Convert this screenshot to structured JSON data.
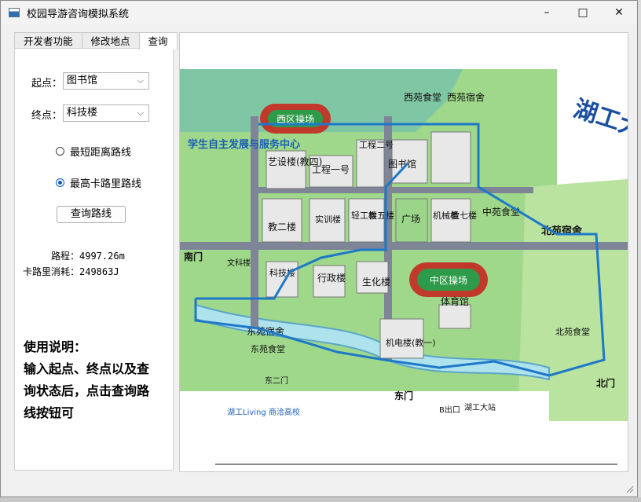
{
  "window": {
    "title": "校园导游咨询模拟系统",
    "min_icon": "minimize-icon",
    "max_icon": "maximize-icon",
    "close_icon": "close-icon"
  },
  "tabs": [
    "开发者功能",
    "修改地点",
    "查询"
  ],
  "active_tab": "查询",
  "form": {
    "start_label": "起点：",
    "start_value": "图书馆",
    "end_label": "终点：",
    "end_value": "科技楼",
    "option_short": "最短距离路线",
    "option_calorie": "最高卡路里路线",
    "selected_option": "最高卡路里路线",
    "query_button": "查询路线"
  },
  "result": {
    "distance": "路程：4997.26m",
    "calories": "卡路里消耗：249863J"
  },
  "help": {
    "title": "使用说明：",
    "text": "输入起点、终点以及查询状态后，点击查询路线按钮可"
  },
  "map": {
    "title": "湖工大地图",
    "banner": "学生自主发展与服务中心",
    "labels": {
      "west_field": "西区操场",
      "west_canteen": "西苑食堂",
      "west_dorm": "西苑宿舍",
      "art": "艺设楼(教四)",
      "eng1": "工程一号",
      "eng2": "工程二号",
      "library": "图书馆",
      "teach2": "教二楼",
      "train": "实训楼",
      "light": "轻工楼",
      "teach5": "教五楼",
      "square": "广场",
      "mech": "机械楼",
      "teach7": "教七楼",
      "mid_canteen": "中苑食堂",
      "north_dorm": "北苑宿舍",
      "south_gate": "南门",
      "science": "科技楼",
      "wenke": "文科楼",
      "admin": "行政楼",
      "bio": "生化楼",
      "mid_field": "中区操场",
      "gym": "体育馆",
      "east_dorm": "东苑宿舍",
      "east_canteen": "东苑食堂",
      "east2_gate": "东二门",
      "east_gate": "东门",
      "mechelec": "机电楼(教一)",
      "b_exit": "B出口",
      "station": "湖工大站",
      "north_canteen": "北苑食堂",
      "north_gate": "北门",
      "footer": "湖工Living 商洽高校"
    },
    "colors": {
      "grass": "#8fcf6e",
      "road": "#7d8596",
      "route": "#1e78c8",
      "water": "#aee3ee",
      "track": "#c0392b"
    }
  }
}
